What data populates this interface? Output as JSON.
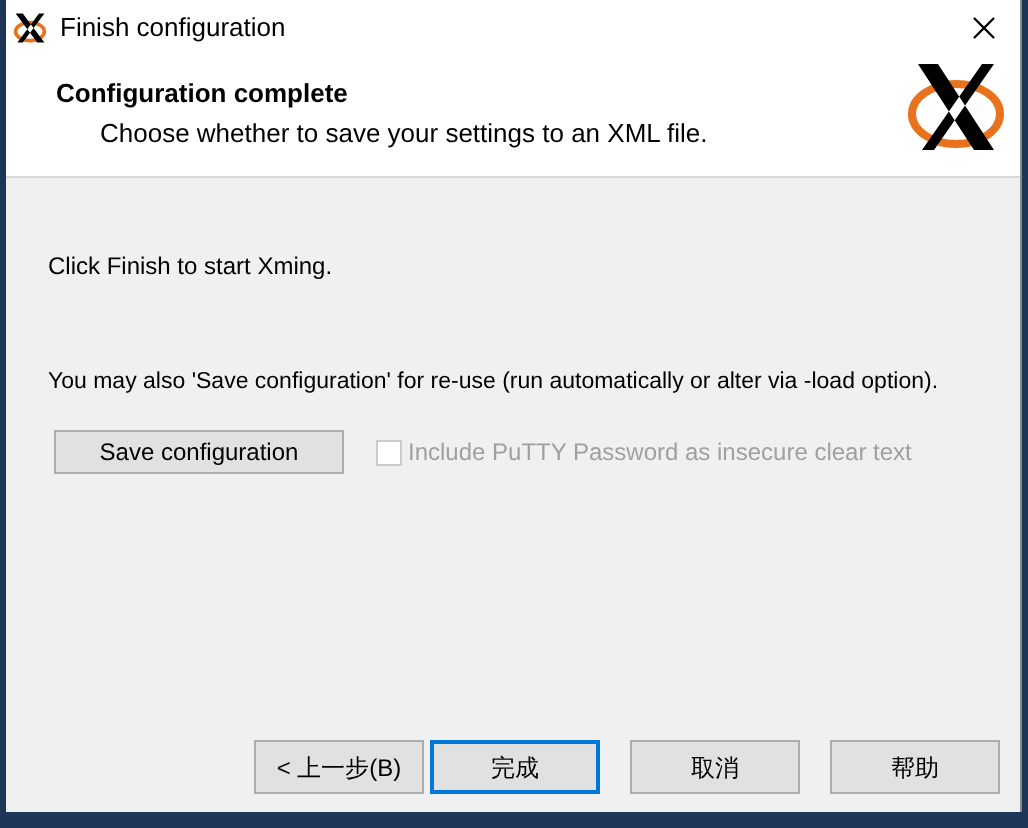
{
  "window": {
    "title": "Finish configuration"
  },
  "header": {
    "title": "Configuration complete",
    "subtitle": "Choose whether to save your settings to an XML file."
  },
  "body": {
    "start_text": "Click Finish to start Xming.",
    "save_text": "You may also 'Save configuration' for re-use (run automatically or alter via -load option).",
    "save_button": "Save configuration",
    "checkbox": {
      "label": "Include PuTTY Password as insecure clear text",
      "checked": false,
      "disabled": true
    }
  },
  "buttons": [
    {
      "label": "< 上一步(B)",
      "default": false
    },
    {
      "label": "完成",
      "default": true
    },
    {
      "label": "取消",
      "default": false
    },
    {
      "label": "帮助",
      "default": false
    }
  ]
}
